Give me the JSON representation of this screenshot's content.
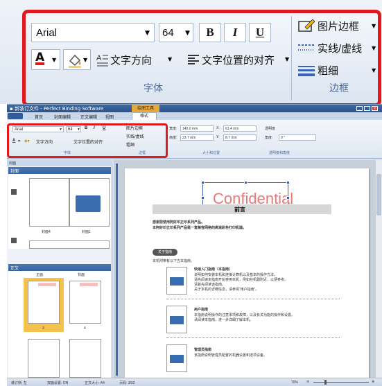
{
  "callout": {
    "font_name": "Arial",
    "font_size": "64",
    "bold": "B",
    "italic": "I",
    "underline": "U",
    "font_color_label": "A",
    "text_direction": "文字方向",
    "text_align": "文字位置的对齐",
    "group_font": "字体",
    "frame": "图片边框",
    "line_style": "实线/虚线",
    "weight": "粗细",
    "group_border": "边框"
  },
  "window": {
    "title": "▪ 新装订文件 - Perfect Binding Software",
    "context_tab": "绘图工具",
    "tabs": [
      "首页",
      "封面编辑",
      "正文编辑",
      "视图",
      "格式"
    ],
    "ribbon": {
      "font_name": "Arial",
      "font_size": "64",
      "b": "B",
      "i": "I",
      "u": "U",
      "text_direction": "文字方向",
      "text_align": "文字位置的对齐",
      "group_font": "字体",
      "frame": "图片边框",
      "line_style": "实线/虚线",
      "weight": "粗细",
      "group_border": "边框",
      "width_label": "宽度:",
      "width": "140.0 mm",
      "height_label": "高度:",
      "height": "23.7 mm",
      "x_label": "X:",
      "x": "61.4 mm",
      "y_label": "Y:",
      "y": "8.7 mm",
      "group_size": "大小和位置",
      "transparency": "透明度",
      "angle_label": "角度:",
      "angle": "0 °",
      "group_trans": "透明度和角度"
    },
    "panel": {
      "title": "封面",
      "cover_section": "封面",
      "cover_pages": [
        "封面4",
        "封面1"
      ],
      "body_section": "正文",
      "cols": [
        "正面",
        "背面"
      ],
      "page_nums": [
        "3",
        "4"
      ]
    },
    "document": {
      "confidential": "Confidential",
      "heading": "前言",
      "intro1": "感谢您使用阿好印正印系列产品。",
      "intro2": "本阿好印正印系列产品是一套兼容网络的高速彩色打印机器。",
      "guide_title": "关于指南",
      "guide_sub": "本机附带有以下五本指南。",
      "item1_title": "快速入门指南（本指南）",
      "item1_desc": [
        "说明如何安装本机和连接计算机以及基本的操作方法。",
        "请先阅读本指南开始使用本机，例如在机器附近、以便参考。",
        "请首先阅读该指南。",
        "关于本机的详细信息，请参阅“用户指南”。"
      ],
      "item2_title": "用户指南",
      "item2_desc": [
        "本指南说明操作的注意事项和故障，以及有关功能的操作和设置。",
        "请阅读本指南，进一步详细了解本机。"
      ],
      "item3_title": "管理员指南",
      "item3_desc": [
        "该指南说明管理员配置的机器设置和选项设备。"
      ]
    },
    "status": {
      "layout": "装订侧: 左",
      "duplex": "双面设置: ON",
      "size": "正文大小: A4",
      "pages": "页码: 3/52",
      "zoom": "70%"
    }
  }
}
